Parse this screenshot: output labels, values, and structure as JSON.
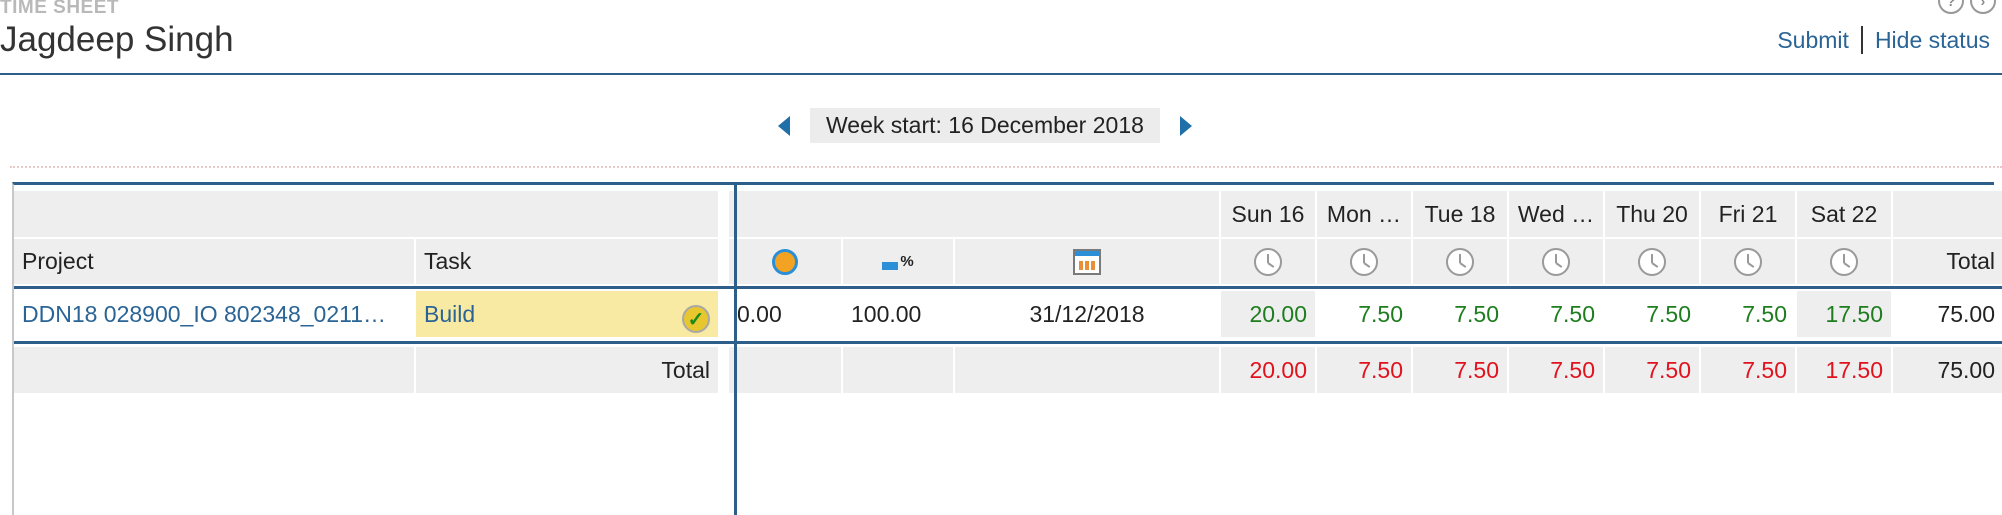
{
  "header": {
    "section_label": "TIME SHEET",
    "user_name": "Jagdeep Singh",
    "submit_label": "Submit",
    "hide_status_label": "Hide status"
  },
  "week": {
    "label": "Week start: 16 December 2018"
  },
  "table": {
    "left_headers": {
      "project": "Project",
      "task": "Task"
    },
    "days": [
      "Sun 16",
      "Mon …",
      "Tue 18",
      "Wed …",
      "Thu 20",
      "Fri 21",
      "Sat 22"
    ],
    "total_header": "Total",
    "row": {
      "project": "DDN18 028900_IO 802348_0211…",
      "task": "Build",
      "col1": "0.00",
      "col2": "100.00",
      "col3": "31/12/2018",
      "hours": [
        "20.00",
        "7.50",
        "7.50",
        "7.50",
        "7.50",
        "7.50",
        "17.50"
      ],
      "total": "75.00"
    },
    "totals_row": {
      "label": "Total",
      "hours": [
        "20.00",
        "7.50",
        "7.50",
        "7.50",
        "7.50",
        "7.50",
        "17.50"
      ],
      "total": "75.00"
    }
  },
  "colors": {
    "accent": "#2e5f8a",
    "link": "#2a6496",
    "hours_green": "#1e7d1e",
    "totals_red": "#e0121e",
    "task_highlight": "#f8eaa3"
  }
}
